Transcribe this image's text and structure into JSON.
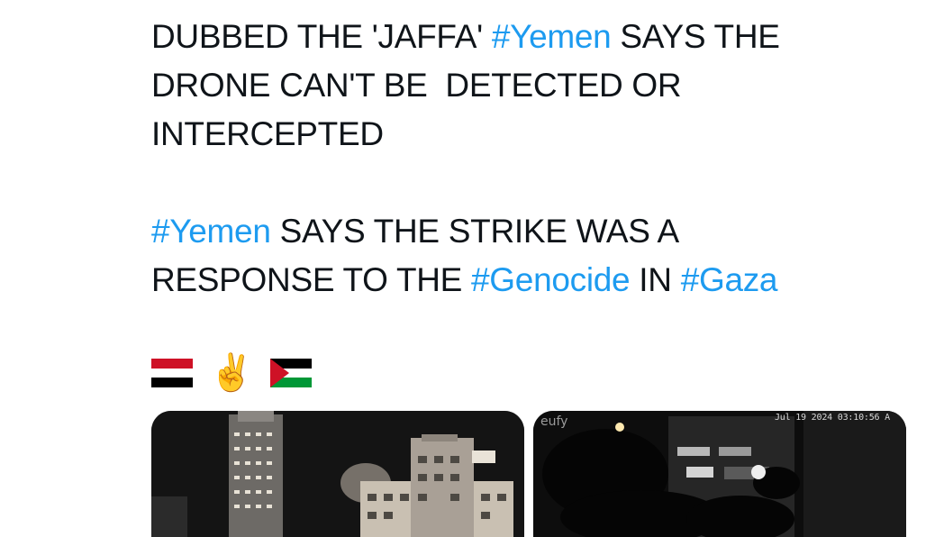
{
  "tweet": {
    "lines": [
      [
        {
          "t": "DUBBED THE 'JAFFA' "
        },
        {
          "h": "#Yemen"
        },
        {
          "t": " SAYS THE"
        }
      ],
      [
        {
          "t": "DRONE CAN'T BE  DETECTED OR"
        }
      ],
      [
        {
          "t": "INTERCEPTED"
        }
      ],
      null,
      [
        {
          "h": "#Yemen"
        },
        {
          "t": " SAYS THE STRIKE WAS A"
        }
      ],
      [
        {
          "t": "RESPONSE TO THE "
        },
        {
          "h": "#Genocide"
        },
        {
          "t": " IN "
        },
        {
          "h": "#Gaza"
        }
      ]
    ],
    "emojis": [
      "yemen-flag-icon",
      "victory-hand-icon",
      "palestine-flag-icon"
    ],
    "peace_glyph": "✌️"
  },
  "media": {
    "right": {
      "brand": "eufy",
      "timestamp": "Jul 19 2024  03:10:56 A"
    }
  },
  "colors": {
    "hashtag": "#1d9bf0",
    "text": "#0f1419"
  }
}
